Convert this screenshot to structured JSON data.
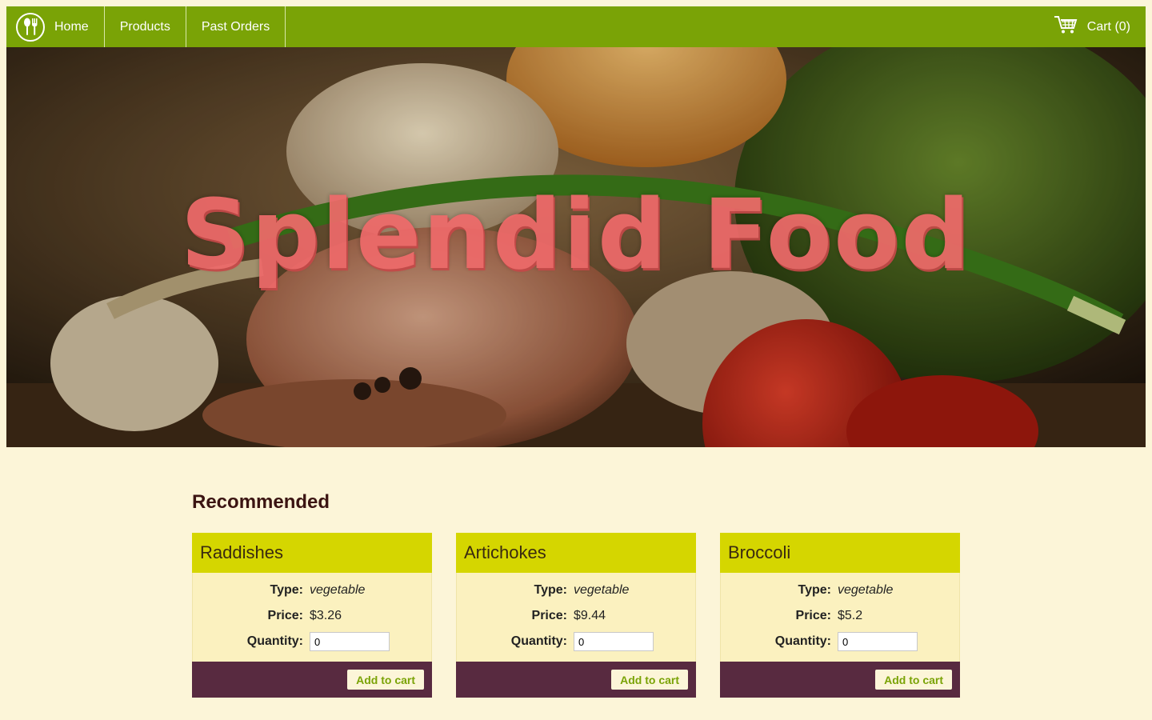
{
  "nav": {
    "home_label": "Home",
    "products_label": "Products",
    "past_orders_label": "Past Orders",
    "cart_label": "Cart (0)"
  },
  "hero": {
    "title": "Splendid Food"
  },
  "recommended": {
    "heading": "Recommended",
    "type_label": "Type:",
    "price_label": "Price:",
    "quantity_label": "Quantity:",
    "add_button_label": "Add to cart",
    "products": [
      {
        "name": "Raddishes",
        "type": "vegetable",
        "price": "$3.26",
        "quantity": "0"
      },
      {
        "name": "Artichokes",
        "type": "vegetable",
        "price": "$9.44",
        "quantity": "0"
      },
      {
        "name": "Broccoli",
        "type": "vegetable",
        "price": "$5.2",
        "quantity": "0"
      }
    ]
  },
  "colors": {
    "nav_bg": "#7aa306",
    "card_header": "#d5d600",
    "card_footer": "#582a40",
    "page_bg": "#fcf5d8",
    "hero_title": "#ef6a6a"
  },
  "icons": {
    "logo": "fork-spoon-icon",
    "cart": "shopping-cart-icon"
  }
}
